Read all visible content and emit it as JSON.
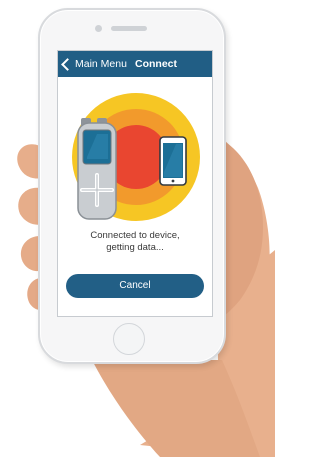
{
  "screen": {
    "back_label": "Main Menu",
    "title": "Connect",
    "status_line1": "Connected to device,",
    "status_line2": "getting data...",
    "cancel_label": "Cancel"
  },
  "colors": {
    "app_bar": "#215e85",
    "button": "#225f86",
    "circle_outer": "#f6c624",
    "circle_mid": "#f29a2c",
    "circle_inner": "#e94630",
    "device_screen": "#1c6f96"
  },
  "icons": {
    "back": "chevron-left-icon",
    "meter": "glucose-meter-icon",
    "phone": "smartphone-icon"
  }
}
